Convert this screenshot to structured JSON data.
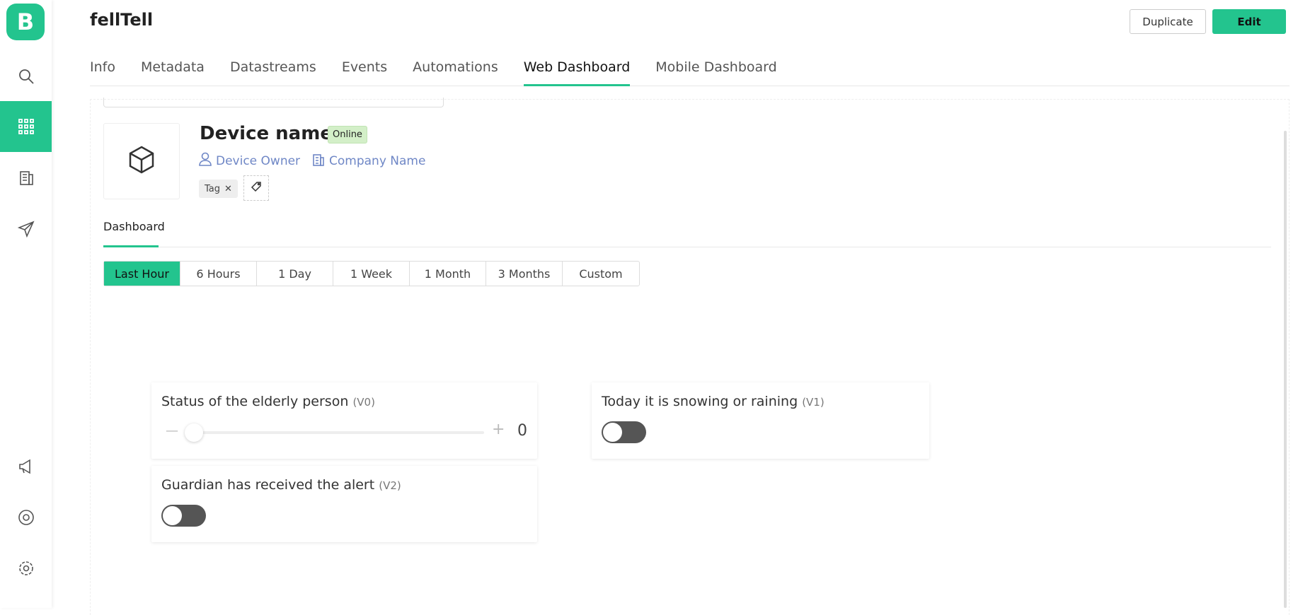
{
  "app": {
    "logo_letter": "B",
    "title": "fellTell"
  },
  "header": {
    "duplicate": "Duplicate",
    "edit": "Edit"
  },
  "tabs": [
    "Info",
    "Metadata",
    "Datastreams",
    "Events",
    "Automations",
    "Web Dashboard",
    "Mobile Dashboard"
  ],
  "active_tab": "Web Dashboard",
  "device": {
    "name": "Device name",
    "status": "Online",
    "owner": "Device Owner",
    "company": "Company Name",
    "tag": "Tag"
  },
  "subtab": "Dashboard",
  "ranges": [
    "Last Hour",
    "6 Hours",
    "1 Day",
    "1 Week",
    "1 Month",
    "3 Months",
    "Custom"
  ],
  "widgets": [
    {
      "title": "Status of the elderly person",
      "pin": "(V0)",
      "type": "slider",
      "value": "0",
      "slider_fraction": 0
    },
    {
      "title": "Today it is snowing or raining",
      "pin": "(V1)",
      "type": "switch",
      "on": false
    },
    {
      "title": "Guardian has received the alert",
      "pin": "(V2)",
      "type": "switch",
      "on": false
    }
  ],
  "colors": {
    "accent": "#23c48e",
    "link": "#6f87c6"
  }
}
